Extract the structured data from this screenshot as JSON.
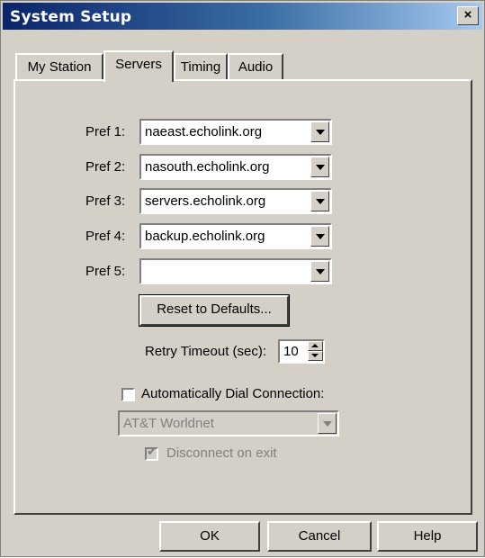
{
  "window": {
    "title": "System Setup",
    "close_glyph": "×"
  },
  "tabs": [
    {
      "label": "My Station",
      "active": false
    },
    {
      "label": "Servers",
      "active": true
    },
    {
      "label": "Timing",
      "active": false
    },
    {
      "label": "Audio",
      "active": false
    }
  ],
  "servers": [
    {
      "label": "Pref 1:",
      "value": "naeast.echolink.org"
    },
    {
      "label": "Pref 2:",
      "value": "nasouth.echolink.org"
    },
    {
      "label": "Pref 3:",
      "value": "servers.echolink.org"
    },
    {
      "label": "Pref 4:",
      "value": "backup.echolink.org"
    },
    {
      "label": "Pref 5:",
      "value": ""
    }
  ],
  "reset_button": "Reset to Defaults...",
  "retry": {
    "label": "Retry Timeout (sec):",
    "value": "10"
  },
  "auto_dial": {
    "label": "Automatically Dial Connection:",
    "checked": false
  },
  "connection": {
    "value": "AT&T Worldnet",
    "enabled": false
  },
  "disconnect": {
    "label": "Disconnect on exit",
    "checked": true,
    "enabled": false,
    "check_glyph": "✔"
  },
  "buttons": {
    "ok": "OK",
    "cancel": "Cancel",
    "help": "Help"
  },
  "colors": {
    "face": "#d4d0c8",
    "title_start": "#0a246a",
    "title_end": "#a6caf0",
    "disabled_text": "#808080"
  }
}
